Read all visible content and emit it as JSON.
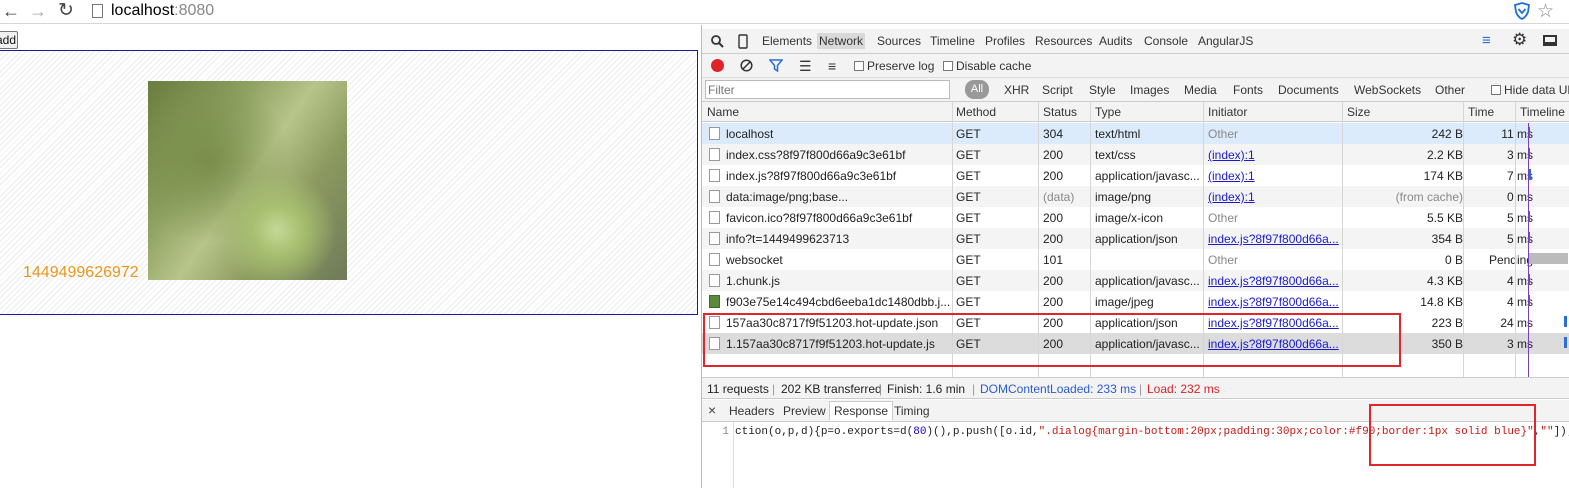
{
  "browser": {
    "url_host": "localhost",
    "url_port": ":8080"
  },
  "page": {
    "add_button": "add",
    "timestamp": "1449499626972",
    "colors": {
      "timestamp": "#e8981a",
      "dialog_border": "#1a1aa0"
    }
  },
  "devtools": {
    "tabs": [
      "Elements",
      "Network",
      "Sources",
      "Timeline",
      "Profiles",
      "Resources",
      "Audits",
      "Console",
      "AngularJS"
    ],
    "active_tab": "Network",
    "toolbar": {
      "preserve_log": "Preserve log",
      "disable_cache": "Disable cache"
    },
    "filter": {
      "placeholder": "Filter",
      "types": [
        "All",
        "XHR",
        "Script",
        "Style",
        "Images",
        "Media",
        "Fonts",
        "Documents",
        "WebSockets",
        "Other"
      ],
      "hide_data": "Hide data URL"
    },
    "columns": [
      "Name",
      "Method",
      "Status",
      "Type",
      "Initiator",
      "Size",
      "Time",
      "Timeline"
    ],
    "rows": [
      {
        "name": "localhost",
        "method": "GET",
        "status": "304",
        "type": "text/html",
        "initiator": "Other",
        "size": "242 B",
        "time": "11 ms"
      },
      {
        "name": "index.css?8f97f800d66a9c3e61bf",
        "method": "GET",
        "status": "200",
        "type": "text/css",
        "initiator": "(index):1",
        "size": "2.2 KB",
        "time": "3 ms"
      },
      {
        "name": "index.js?8f97f800d66a9c3e61bf",
        "method": "GET",
        "status": "200",
        "type": "application/javasc...",
        "initiator": "(index):1",
        "size": "174 KB",
        "time": "7 ms"
      },
      {
        "name": "data:image/png;base...",
        "method": "GET",
        "status": "(data)",
        "type": "image/png",
        "initiator": "(index):1",
        "size": "(from cache)",
        "time": "0 ms"
      },
      {
        "name": "favicon.ico?8f97f800d66a9c3e61bf",
        "method": "GET",
        "status": "200",
        "type": "image/x-icon",
        "initiator": "Other",
        "size": "5.5 KB",
        "time": "5 ms"
      },
      {
        "name": "info?t=1449499623713",
        "method": "GET",
        "status": "200",
        "type": "application/json",
        "initiator": "index.js?8f97f800d66a...",
        "size": "354 B",
        "time": "5 ms"
      },
      {
        "name": "websocket",
        "method": "GET",
        "status": "101",
        "type": "",
        "initiator": "Other",
        "size": "0 B",
        "time": "Pending"
      },
      {
        "name": "1.chunk.js",
        "method": "GET",
        "status": "200",
        "type": "application/javasc...",
        "initiator": "index.js?8f97f800d66a...",
        "size": "4.3 KB",
        "time": "4 ms"
      },
      {
        "name": "f903e75e14c494cbd6eeba1dc1480dbb.j...",
        "method": "GET",
        "status": "200",
        "type": "image/jpeg",
        "initiator": "index.js?8f97f800d66a...",
        "size": "14.8 KB",
        "time": "4 ms"
      },
      {
        "name": "157aa30c8717f9f51203.hot-update.json",
        "method": "GET",
        "status": "200",
        "type": "application/json",
        "initiator": "index.js?8f97f800d66a...",
        "size": "223 B",
        "time": "24 ms"
      },
      {
        "name": "1.157aa30c8717f9f51203.hot-update.js",
        "method": "GET",
        "status": "200",
        "type": "application/javasc...",
        "initiator": "index.js?8f97f800d66a...",
        "size": "350 B",
        "time": "3 ms"
      }
    ],
    "summary": {
      "requests": "11 requests",
      "transferred": "202 KB transferred",
      "finish": "Finish: 1.6 min",
      "dom_loaded": "DOMContentLoaded: 233 ms",
      "load": "Load: 232 ms"
    },
    "detail_tabs": [
      "Headers",
      "Preview",
      "Response",
      "Timing"
    ],
    "active_detail_tab": "Response",
    "response": {
      "line_number": "1",
      "code_prefix": "ction(o,p,d){p=o.exports=d(",
      "code_num": "80",
      "code_mid": ")(),p.push([o.id,",
      "code_str1": "\".dialog{margin-bottom:20px;padding:30px;color:#f90;border:1px solid blue}\"",
      "code_comma": ",",
      "code_str2": "\"\"",
      "code_suffix": "]);"
    },
    "colors": {
      "waterfall": "#2a6fd6",
      "link": "#1a1ad0",
      "dom_loaded": "#2a5bd7",
      "load": "#d8232a",
      "highlight_box": "#e0252b"
    }
  }
}
